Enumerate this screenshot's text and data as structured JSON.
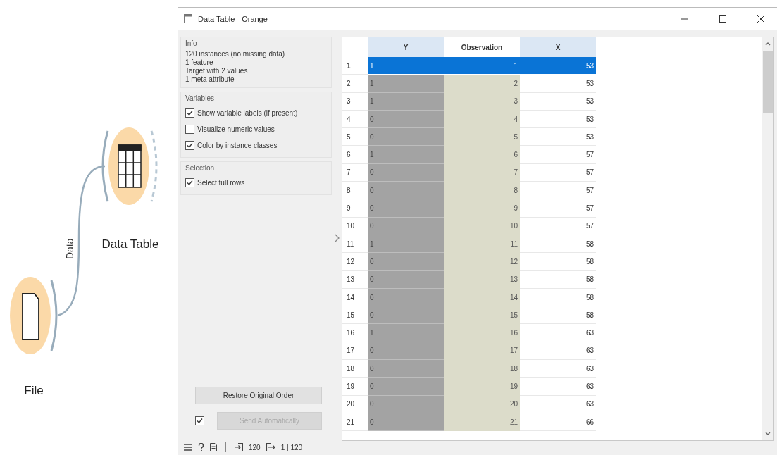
{
  "window": {
    "title": "Data Table - Orange"
  },
  "canvas": {
    "nodes": [
      {
        "label": "Data Table",
        "kind": "table"
      },
      {
        "label": "File",
        "kind": "file"
      }
    ],
    "link": {
      "label": "Data"
    }
  },
  "info": {
    "title": "Info",
    "lines": [
      "120 instances (no missing data)",
      "1 feature",
      "Target with 2 values",
      "1 meta attribute"
    ]
  },
  "variables": {
    "title": "Variables",
    "options": [
      {
        "label": "Show variable labels (if present)",
        "checked": true
      },
      {
        "label": "Visualize numeric values",
        "checked": false
      },
      {
        "label": "Color by instance classes",
        "checked": true
      }
    ]
  },
  "selection": {
    "title": "Selection",
    "options": [
      {
        "label": "Select full rows",
        "checked": true
      }
    ]
  },
  "restore_button": "Restore Original Order",
  "auto_send": {
    "label": "Send Automatically",
    "checked": true,
    "disabled": true
  },
  "table": {
    "columns": [
      {
        "name": "Y",
        "kind": "class"
      },
      {
        "name": "Observation",
        "kind": "meta"
      },
      {
        "name": "X",
        "kind": "feature"
      }
    ],
    "rows": [
      {
        "index": "1",
        "cells": [
          "1",
          "1",
          "53"
        ],
        "selected": true
      },
      {
        "index": "2",
        "cells": [
          "1",
          "2",
          "53"
        ],
        "selected": false
      },
      {
        "index": "3",
        "cells": [
          "1",
          "3",
          "53"
        ],
        "selected": false
      },
      {
        "index": "4",
        "cells": [
          "0",
          "4",
          "53"
        ],
        "selected": false
      },
      {
        "index": "5",
        "cells": [
          "0",
          "5",
          "53"
        ],
        "selected": false
      },
      {
        "index": "6",
        "cells": [
          "1",
          "6",
          "57"
        ],
        "selected": false
      },
      {
        "index": "7",
        "cells": [
          "0",
          "7",
          "57"
        ],
        "selected": false
      },
      {
        "index": "8",
        "cells": [
          "0",
          "8",
          "57"
        ],
        "selected": false
      },
      {
        "index": "9",
        "cells": [
          "0",
          "9",
          "57"
        ],
        "selected": false
      },
      {
        "index": "10",
        "cells": [
          "0",
          "10",
          "57"
        ],
        "selected": false
      },
      {
        "index": "11",
        "cells": [
          "1",
          "11",
          "58"
        ],
        "selected": false
      },
      {
        "index": "12",
        "cells": [
          "0",
          "12",
          "58"
        ],
        "selected": false
      },
      {
        "index": "13",
        "cells": [
          "0",
          "13",
          "58"
        ],
        "selected": false
      },
      {
        "index": "14",
        "cells": [
          "0",
          "14",
          "58"
        ],
        "selected": false
      },
      {
        "index": "15",
        "cells": [
          "0",
          "15",
          "58"
        ],
        "selected": false
      },
      {
        "index": "16",
        "cells": [
          "1",
          "16",
          "63"
        ],
        "selected": false
      },
      {
        "index": "17",
        "cells": [
          "0",
          "17",
          "63"
        ],
        "selected": false
      },
      {
        "index": "18",
        "cells": [
          "0",
          "18",
          "63"
        ],
        "selected": false
      },
      {
        "index": "19",
        "cells": [
          "0",
          "19",
          "63"
        ],
        "selected": false
      },
      {
        "index": "20",
        "cells": [
          "0",
          "20",
          "63"
        ],
        "selected": false
      },
      {
        "index": "21",
        "cells": [
          "0",
          "21",
          "66"
        ],
        "selected": false
      }
    ]
  },
  "status_bar": {
    "input_count": "120",
    "output_count": "1 | 120"
  }
}
